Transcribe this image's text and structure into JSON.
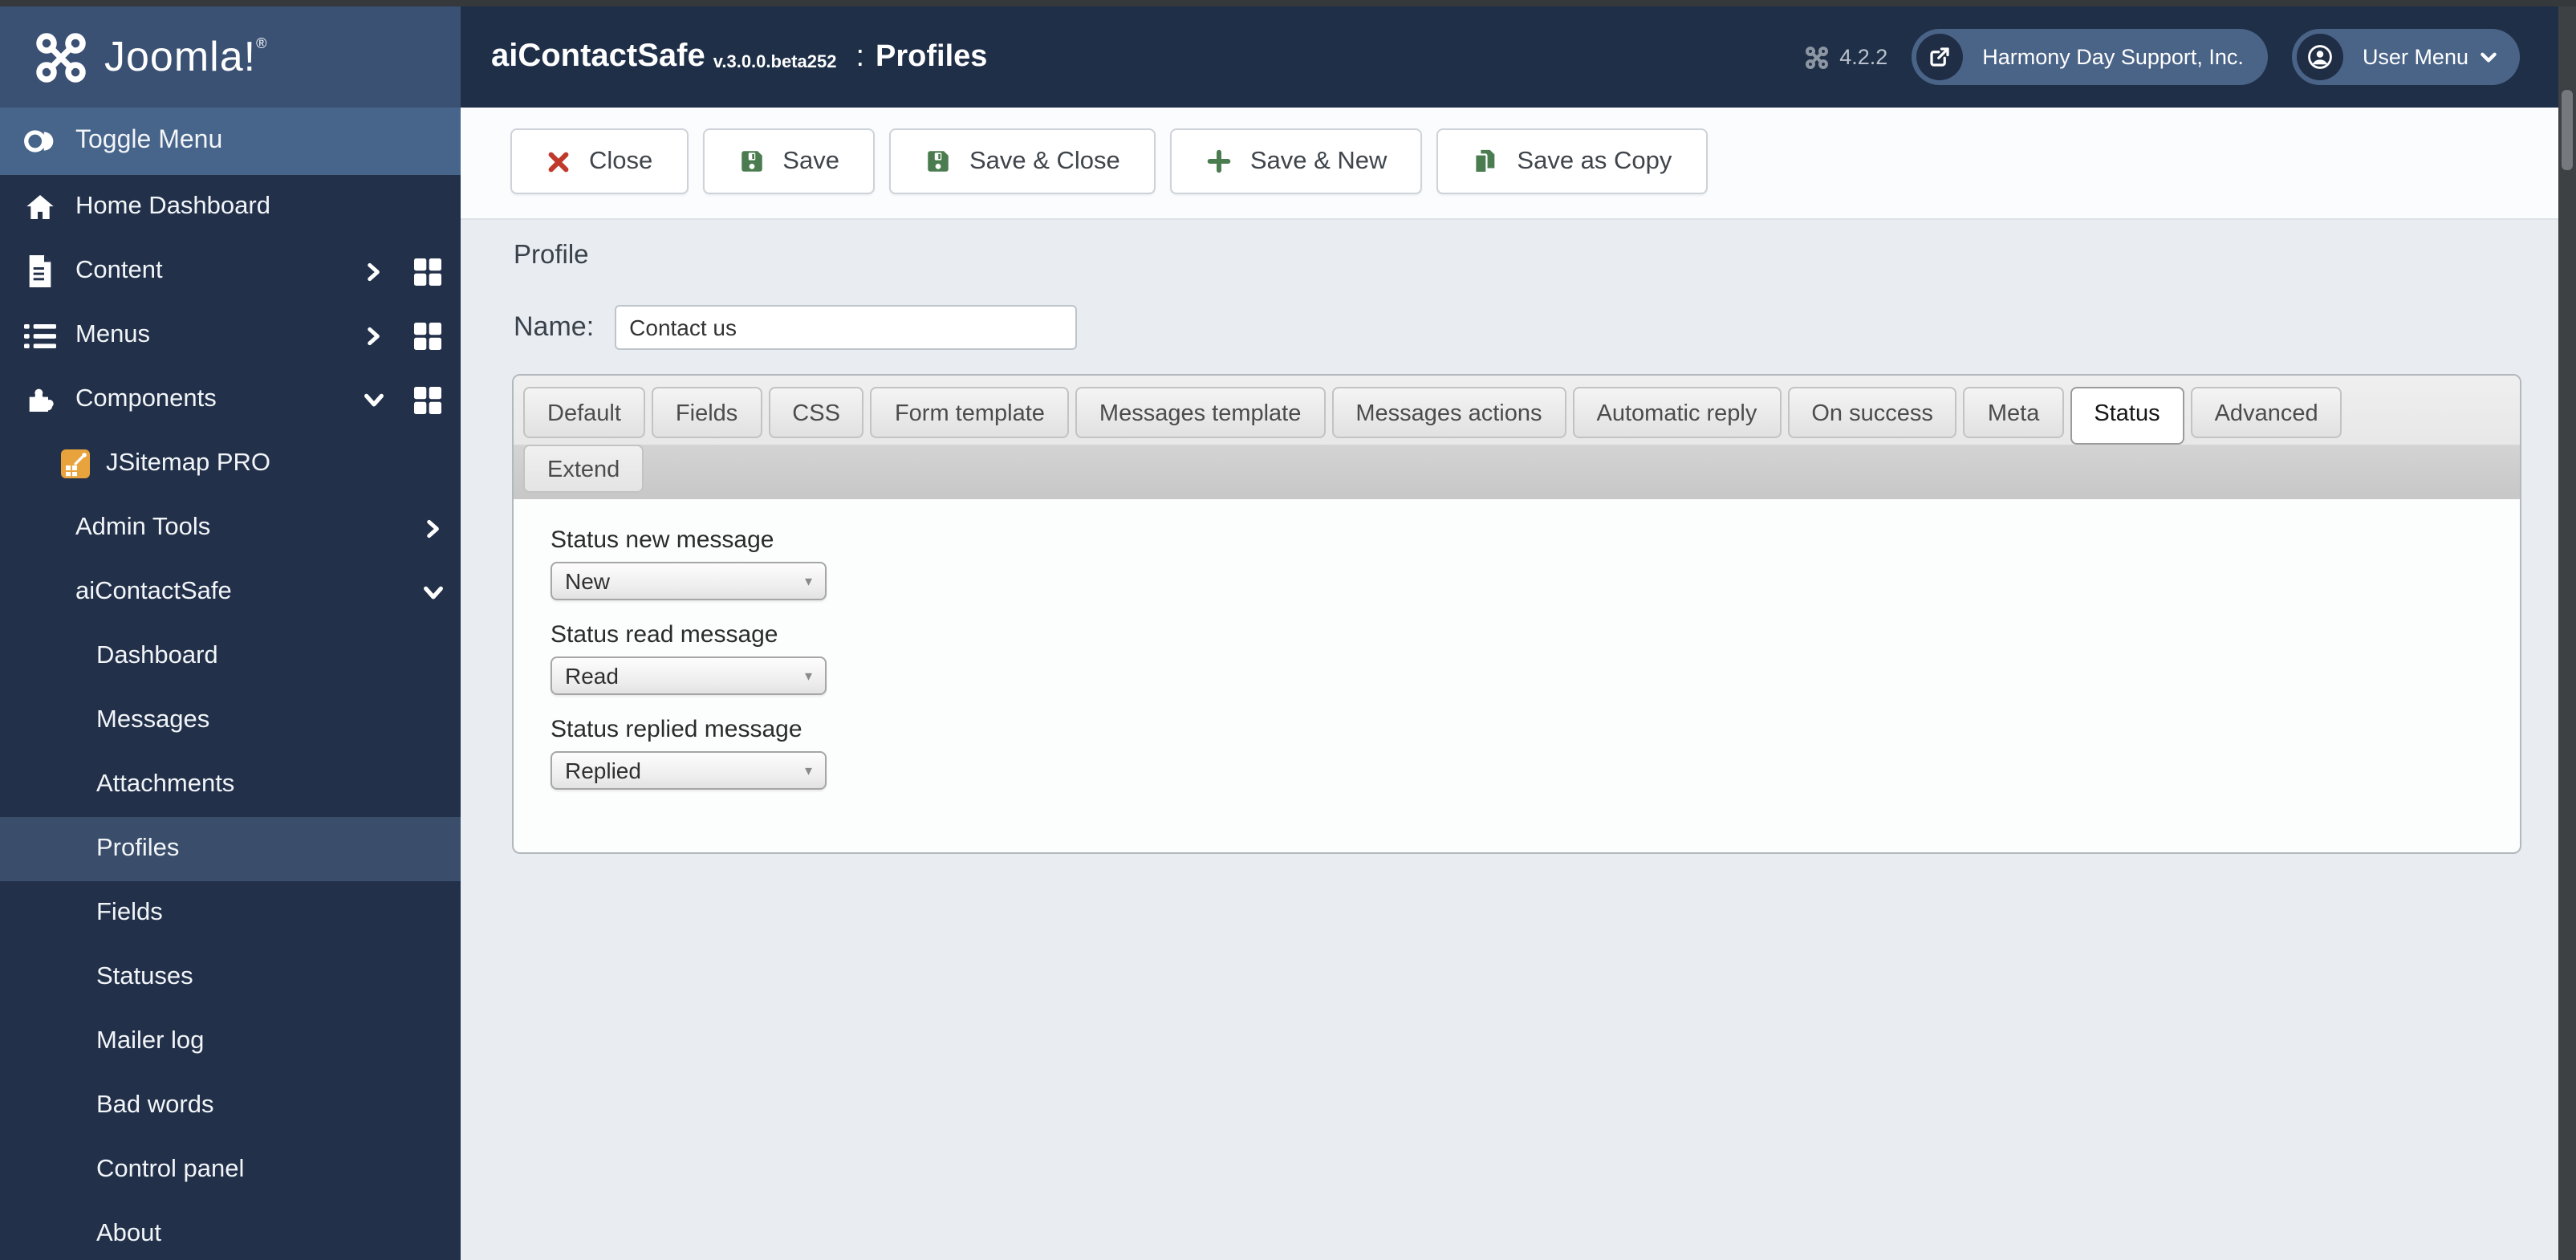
{
  "header": {
    "logo_text": "Joomla!",
    "logo_reg": "®",
    "app_title": "aiContactSafe",
    "app_version": "v.3.0.0.beta252",
    "page_sep": ":",
    "page_title": "Profiles",
    "cms_version": "4.2.2",
    "site_button_label": "Harmony Day Support, Inc.",
    "user_menu_label": "User Menu"
  },
  "sidebar": {
    "toggle_label": "Toggle Menu",
    "items": [
      {
        "label": "Home Dashboard",
        "icon": "home-icon",
        "level": "top"
      },
      {
        "label": "Content",
        "icon": "file-icon",
        "level": "top",
        "chevron": "right",
        "grid": true
      },
      {
        "label": "Menus",
        "icon": "list-icon",
        "level": "top",
        "chevron": "right",
        "grid": true
      },
      {
        "label": "Components",
        "icon": "puzzle-icon",
        "level": "top",
        "chevron": "down",
        "grid": true
      },
      {
        "label": "JSitemap PRO",
        "icon": "jsitemap-icon",
        "level": "sub"
      },
      {
        "label": "Admin Tools",
        "level": "header",
        "chevron": "right"
      },
      {
        "label": "aiContactSafe",
        "level": "header",
        "chevron": "down"
      },
      {
        "label": "Dashboard",
        "level": "sub"
      },
      {
        "label": "Messages",
        "level": "sub"
      },
      {
        "label": "Attachments",
        "level": "sub"
      },
      {
        "label": "Profiles",
        "level": "sub",
        "active": true
      },
      {
        "label": "Fields",
        "level": "sub"
      },
      {
        "label": "Statuses",
        "level": "sub"
      },
      {
        "label": "Mailer log",
        "level": "sub"
      },
      {
        "label": "Bad words",
        "level": "sub"
      },
      {
        "label": "Control panel",
        "level": "sub"
      },
      {
        "label": "About",
        "level": "sub"
      }
    ]
  },
  "toolbar": {
    "buttons": [
      {
        "label": "Close",
        "icon": "close-icon"
      },
      {
        "label": "Save",
        "icon": "save-icon"
      },
      {
        "label": "Save & Close",
        "icon": "save-icon"
      },
      {
        "label": "Save & New",
        "icon": "plus-icon"
      },
      {
        "label": "Save as Copy",
        "icon": "copy-icon"
      }
    ]
  },
  "main": {
    "section_title": "Profile",
    "name_label": "Name:",
    "name_value": "Contact us",
    "tabs": [
      "Default",
      "Fields",
      "CSS",
      "Form template",
      "Messages template",
      "Messages actions",
      "Automatic reply",
      "On success",
      "Meta",
      "Status",
      "Advanced"
    ],
    "active_tab": "Status",
    "tabs_row2": [
      "Extend"
    ],
    "fields": [
      {
        "label": "Status new message",
        "value": "New"
      },
      {
        "label": "Status read message",
        "value": "Read"
      },
      {
        "label": "Status replied message",
        "value": "Replied"
      }
    ],
    "select_arrow": "▾"
  },
  "colors": {
    "header_navy": "#1f2f48",
    "logo_block": "#3a5174",
    "sidebar_bg": "#22304a",
    "sidebar_highlight": "#47648a",
    "sidebar_active_item": "#3a4e6b",
    "header_pill": "#4a6488",
    "toolbar_icon_green": "#4a7c50",
    "toolbar_icon_red": "#c0392b",
    "content_bg": "#e9edf2",
    "tab_strip_gray": "#c9c9c9"
  }
}
